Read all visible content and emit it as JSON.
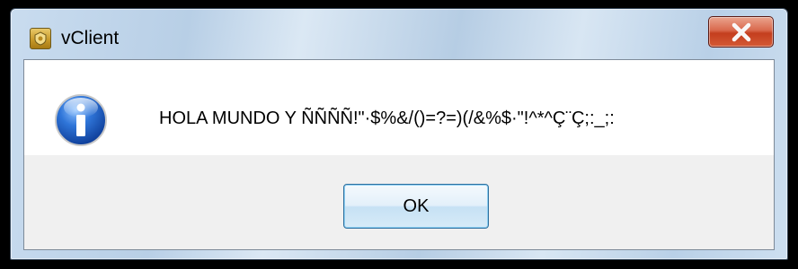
{
  "window": {
    "title": "vClient"
  },
  "titlebar": {
    "app_icon": "vclient-app-icon",
    "close_icon": "close-x-icon"
  },
  "dialog": {
    "icon": "information-icon",
    "message": "HOLA MUNDO Y ÑÑÑÑ!\"·$%&/()=?=)(/&%$·\"!^*^Ç¨Ç;:_;:",
    "ok_label": "OK"
  },
  "colors": {
    "frame_glass": "#c9dcef",
    "close_button_red": "#c43e1e",
    "ok_button_border": "#2e6f9e",
    "info_icon_blue": "#1f5fc4"
  }
}
